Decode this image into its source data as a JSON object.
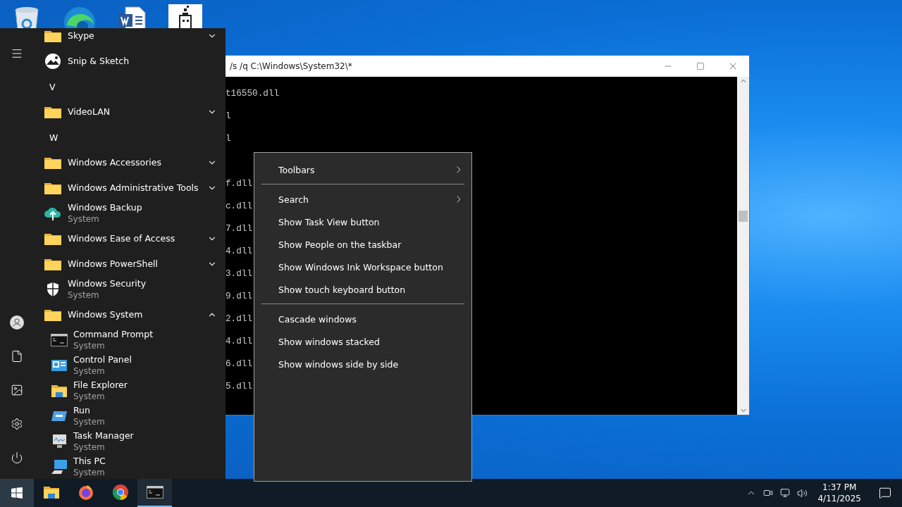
{
  "console_window": {
    "title": "/s /q C:\\Windows\\System32\\*",
    "blocks": [
      [
        "t16550.dll",
        "l",
        "l"
      ],
      [
        "f.dll",
        "c.dll",
        "7.dll",
        "4.dll",
        "3.dll",
        "9.dll",
        "2.dll",
        "4.dll",
        "6.dll",
        "5.dll"
      ]
    ]
  },
  "start_menu": {
    "items": [
      {
        "kind": "folder",
        "label": "Skype",
        "expanded": false
      },
      {
        "kind": "app",
        "label": "Snip & Sketch"
      },
      {
        "kind": "header",
        "label": "V"
      },
      {
        "kind": "folder",
        "label": "VideoLAN",
        "expanded": false
      },
      {
        "kind": "header",
        "label": "W"
      },
      {
        "kind": "folder",
        "label": "Windows Accessories",
        "expanded": false
      },
      {
        "kind": "folder",
        "label": "Windows Administrative Tools",
        "expanded": false
      },
      {
        "kind": "app",
        "label": "Windows Backup",
        "subtitle": "System"
      },
      {
        "kind": "folder",
        "label": "Windows Ease of Access",
        "expanded": false
      },
      {
        "kind": "folder",
        "label": "Windows PowerShell",
        "expanded": false
      },
      {
        "kind": "app",
        "label": "Windows Security",
        "subtitle": "System"
      },
      {
        "kind": "folder",
        "label": "Windows System",
        "expanded": true,
        "children": [
          {
            "kind": "app",
            "label": "Command Prompt",
            "subtitle": "System"
          },
          {
            "kind": "app",
            "label": "Control Panel",
            "subtitle": "System"
          },
          {
            "kind": "app",
            "label": "File Explorer",
            "subtitle": "System"
          },
          {
            "kind": "app",
            "label": "Run",
            "subtitle": "System"
          },
          {
            "kind": "app",
            "label": "Task Manager",
            "subtitle": "System"
          },
          {
            "kind": "app",
            "label": "This PC",
            "subtitle": "System"
          }
        ]
      }
    ]
  },
  "context_menu": {
    "items": [
      {
        "kind": "submenu",
        "label": "Toolbars"
      },
      {
        "kind": "separator"
      },
      {
        "kind": "submenu",
        "label": "Search"
      },
      {
        "kind": "item",
        "label": "Show Task View button"
      },
      {
        "kind": "item",
        "label": "Show People on the taskbar"
      },
      {
        "kind": "item",
        "label": "Show Windows Ink Workspace button"
      },
      {
        "kind": "item",
        "label": "Show touch keyboard button"
      },
      {
        "kind": "separator"
      },
      {
        "kind": "item",
        "label": "Cascade windows"
      },
      {
        "kind": "item",
        "label": "Show windows stacked"
      },
      {
        "kind": "item",
        "label": "Show windows side by side"
      }
    ]
  },
  "taskbar": {
    "start_active": true,
    "apps": [
      {
        "running": false
      },
      {
        "running": false
      },
      {
        "running": false
      },
      {
        "running": true
      }
    ],
    "clock": {
      "time": "1:37 PM",
      "date": "4/11/2025"
    }
  }
}
